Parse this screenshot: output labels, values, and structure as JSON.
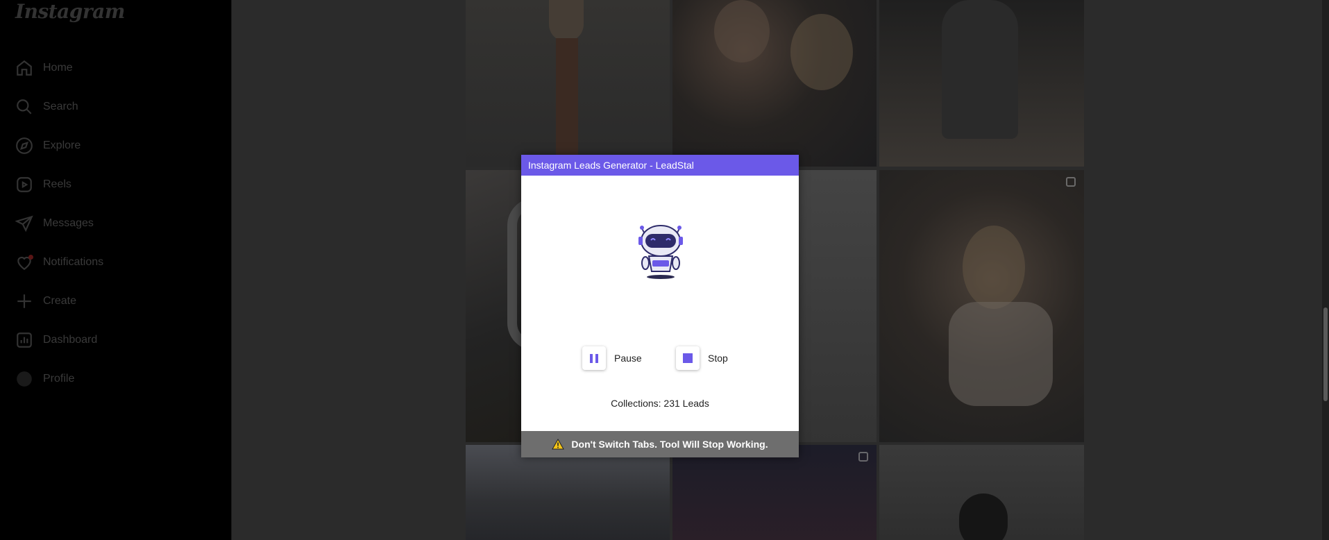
{
  "app": {
    "logo_text": "Instagram"
  },
  "sidebar": {
    "items": [
      {
        "label": "Home",
        "icon": "home-icon"
      },
      {
        "label": "Search",
        "icon": "search-icon"
      },
      {
        "label": "Explore",
        "icon": "compass-icon"
      },
      {
        "label": "Reels",
        "icon": "reels-icon"
      },
      {
        "label": "Messages",
        "icon": "send-icon"
      },
      {
        "label": "Notifications",
        "icon": "heart-icon",
        "has_badge": true
      },
      {
        "label": "Create",
        "icon": "plus-icon"
      },
      {
        "label": "Dashboard",
        "icon": "chart-icon"
      },
      {
        "label": "Profile",
        "icon": "avatar-icon"
      }
    ]
  },
  "dialog": {
    "title": "Instagram Leads Generator - LeadStal",
    "pause_label": "Pause",
    "stop_label": "Stop",
    "collections_text": "Collections: 231 Leads",
    "warning_text": "Don't Switch Tabs. Tool Will Stop Working.",
    "accent_color": "#6b59e8"
  },
  "colors": {
    "warning_bar": "#6e6e6e",
    "overlay_bg": "#2b2b2b"
  }
}
